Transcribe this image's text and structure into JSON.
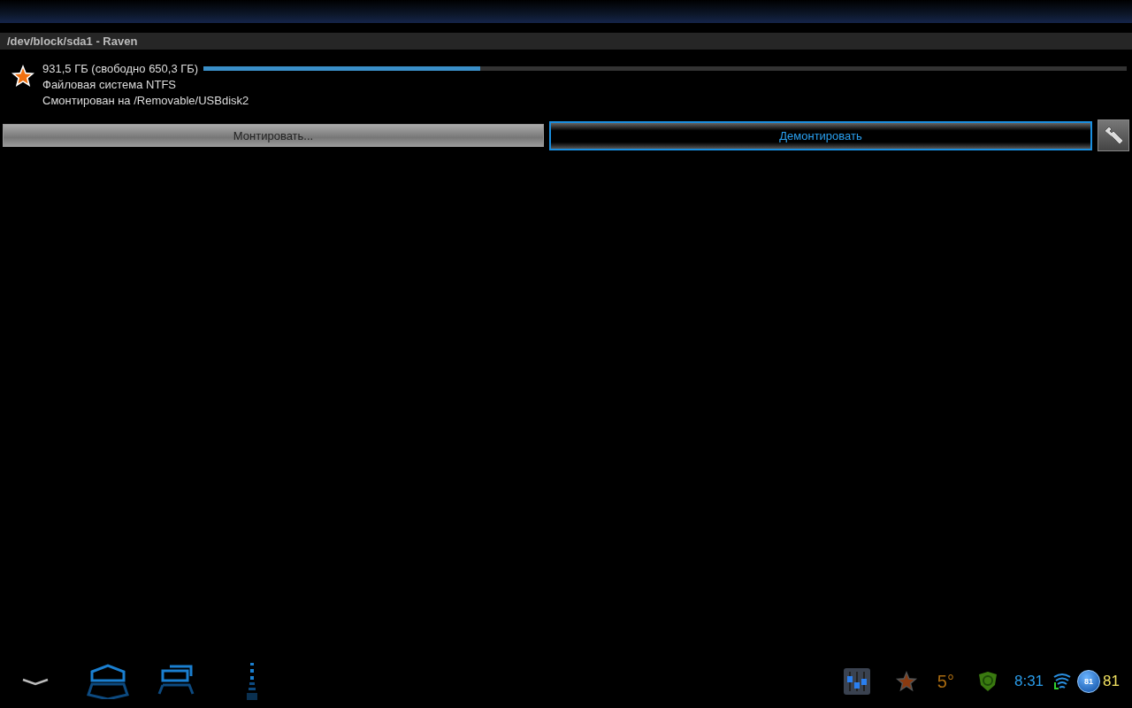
{
  "header": {
    "title": "/dev/block/sda1 - Raven"
  },
  "volume": {
    "favorite": true,
    "size": "931,5 ГБ (свободно 650,3 ГБ)",
    "level": 0.3,
    "filesystem": "Файловая система NTFS",
    "mount_point": "Смонтирован на /Removable/USBdisk2"
  },
  "buttons": [
    {
      "label": "Монтировать...",
      "disabled": true,
      "focused": false
    },
    {
      "label": "Демонтировать",
      "disabled": false,
      "focused": true
    }
  ],
  "status_bar": {
    "temperature": "5°",
    "time": "8:31",
    "battery_badge": "81",
    "battery": "81"
  }
}
